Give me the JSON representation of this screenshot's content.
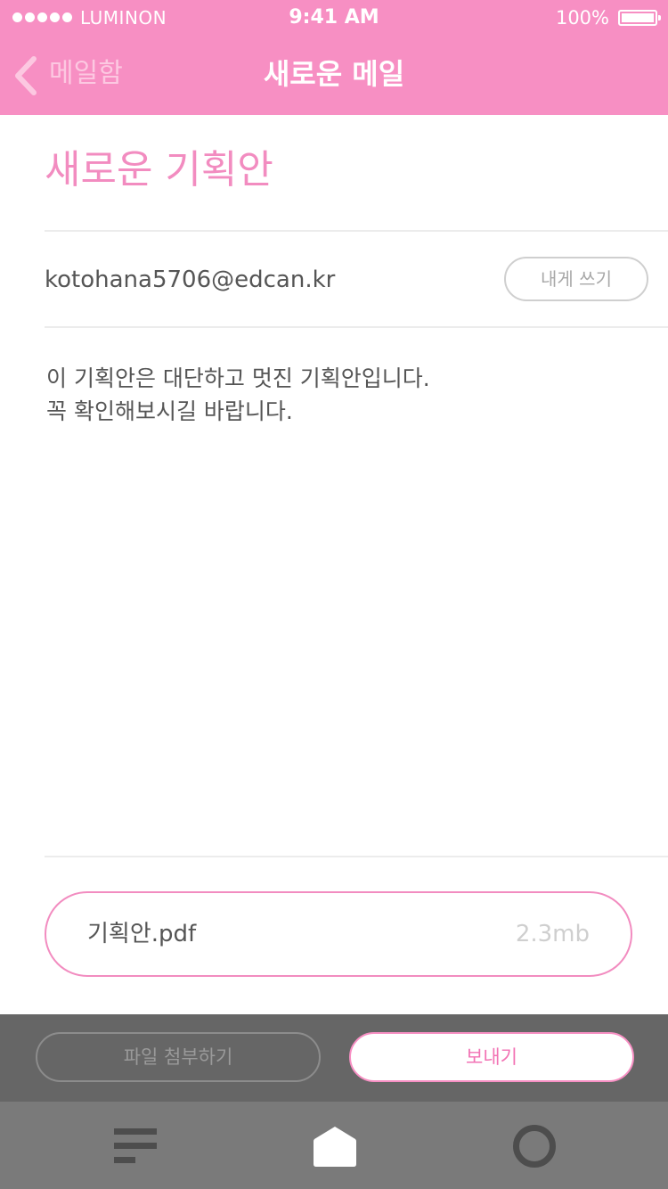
{
  "status_bar": {
    "carrier": "LUMINON",
    "time": "9:41 AM",
    "battery": "100%"
  },
  "nav": {
    "back_label": "메일함",
    "title": "새로운 메일"
  },
  "mail": {
    "subject": "새로운 기획안",
    "recipient": "kotohana5706@edcan.kr",
    "write_to_me_label": "내게 쓰기",
    "body_lines": [
      "이 기획안은 대단하고 멋진 기획안입니다.",
      "꼭 확인해보시길 바랍니다."
    ]
  },
  "attachment": {
    "filename": "기획안.pdf",
    "size": "2.3mb"
  },
  "actions": {
    "attach_file_label": "파일 첨부하기",
    "send_label": "보내기"
  },
  "tab_bar": {
    "items": [
      {
        "icon": "menu-icon"
      },
      {
        "icon": "home-icon"
      },
      {
        "icon": "profile-icon"
      }
    ]
  },
  "colors": {
    "accent": "#F78FC3",
    "action_bar": "#666666",
    "tab_bar": "#7A7A7A"
  }
}
